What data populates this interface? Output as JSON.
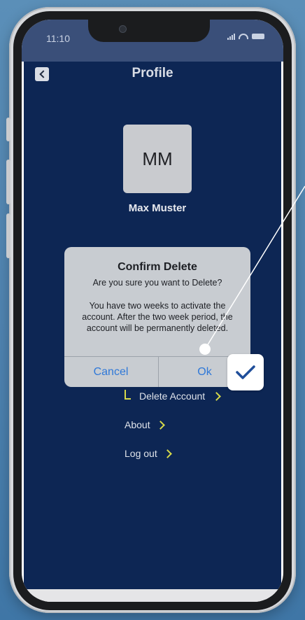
{
  "status_bar": {
    "time": "11:10"
  },
  "header": {
    "title": "Profile"
  },
  "profile": {
    "initials": "MM",
    "name": "Max Muster"
  },
  "menu": {
    "delete_account": "Delete Account",
    "about": "About",
    "log_out": "Log out"
  },
  "dialog": {
    "title": "Confirm Delete",
    "question": "Are you sure you want to Delete?",
    "info": "You have  two weeks to activate the account. After the two week period, the account will be permanently deleted.",
    "cancel_label": "Cancel",
    "ok_label": "Ok"
  },
  "colors": {
    "app_background": "#0d2654",
    "accent_chevron": "#d6d94a",
    "dialog_button": "#2f78d8"
  }
}
